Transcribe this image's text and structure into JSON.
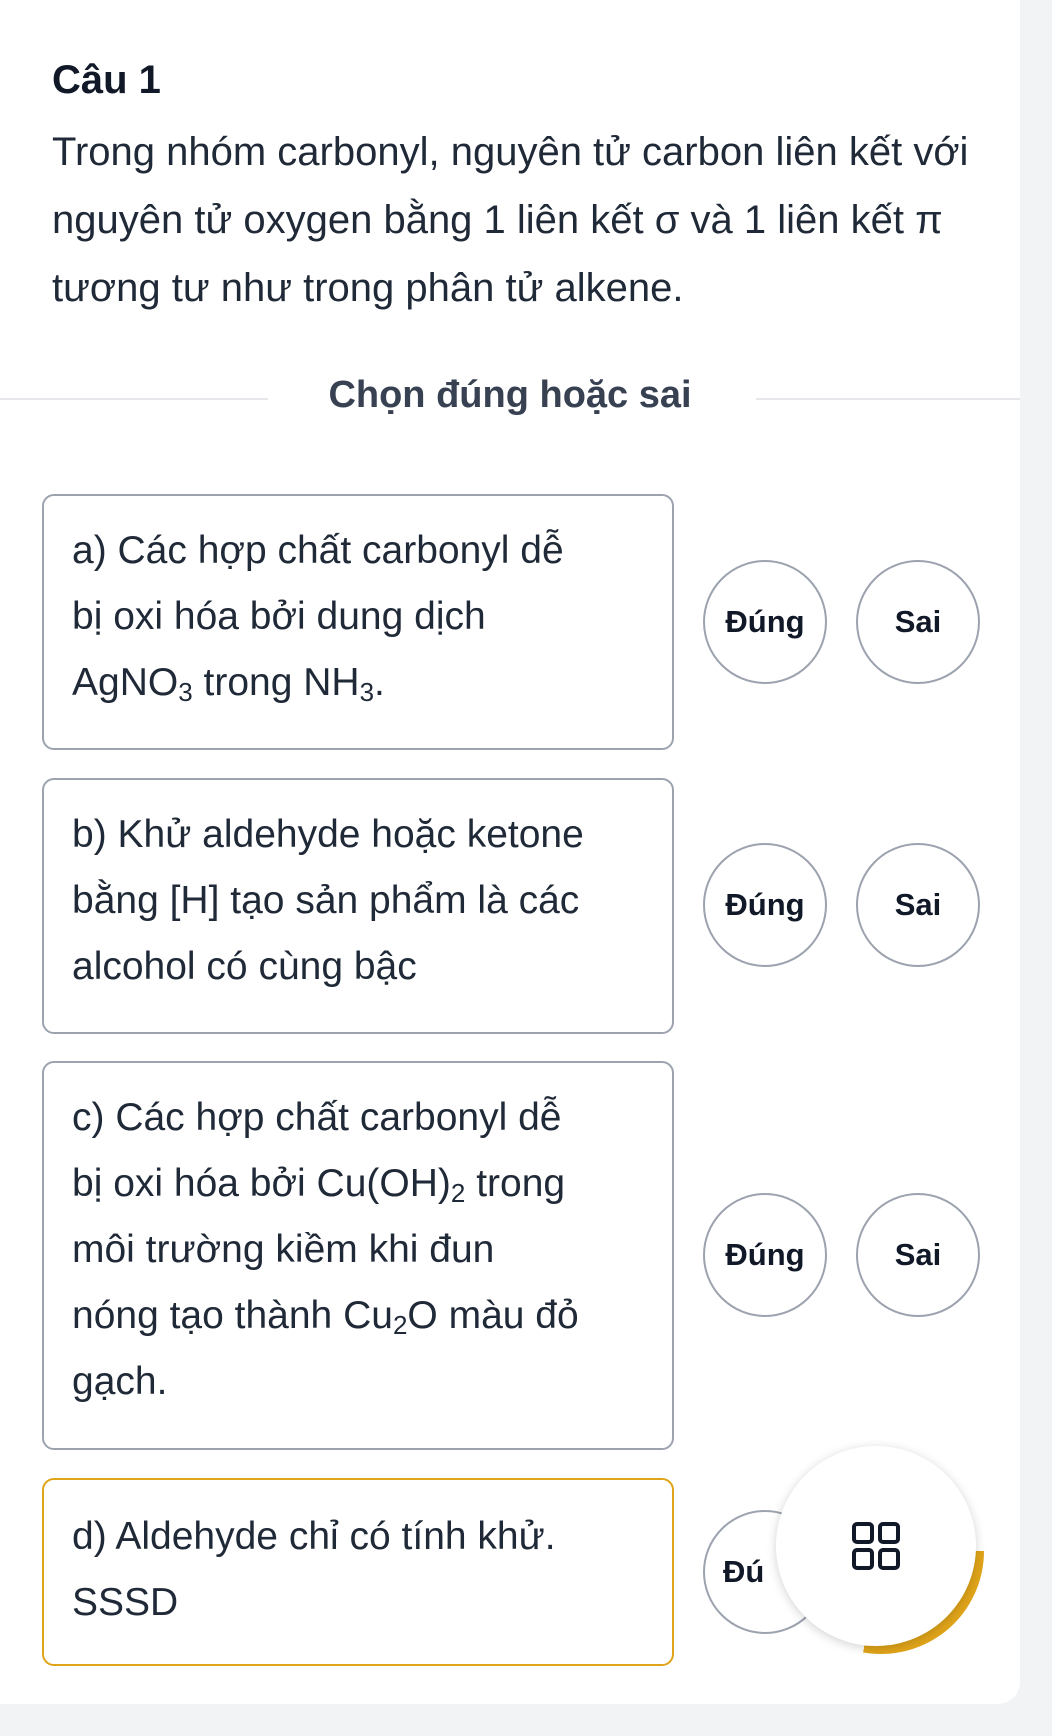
{
  "question": {
    "title": "Câu 1",
    "text": "Trong nhóm carbonyl, nguyên tử carbon liên kết với nguyên tử oxygen bằng 1 liên kết σ và 1 liên kết π tương tư như trong phân tử alkene."
  },
  "divider_label": "Chọn đúng hoặc sai",
  "statements": [
    {
      "line1": "a) Các hợp chất carbonyl dễ",
      "line2": "bị oxi hóa bởi dung dịch",
      "line3_pre": "AgNO",
      "line3_sub1": "3",
      "line3_mid": " trong NH",
      "line3_sub2": "3",
      "line3_post": ".",
      "true_label": "Đúng",
      "false_label": "Sai"
    },
    {
      "line1": "b) Khử aldehyde hoặc ketone",
      "line2": "bằng [H] tạo sản phẩm là các",
      "line3": "alcohol có cùng bậc",
      "true_label": "Đúng",
      "false_label": "Sai"
    },
    {
      "line1": "c) Các hợp chất carbonyl dễ",
      "line2_pre": "bị oxi hóa bởi Cu(OH)",
      "line2_sub": "2",
      "line2_post": " trong",
      "line3": "môi trường kiềm khi đun",
      "line4_pre": "nóng tạo thành Cu",
      "line4_sub": "2",
      "line4_post": "O màu đỏ",
      "line5": "gạch.",
      "true_label": "Đúng",
      "false_label": "Sai"
    },
    {
      "line1": "d) Aldehyde chỉ có tính khử.",
      "line2": "SSSD",
      "true_label_partial": "Đú"
    }
  ],
  "fab": {
    "icon": "grid-icon",
    "accent_color": "#e0a419"
  }
}
